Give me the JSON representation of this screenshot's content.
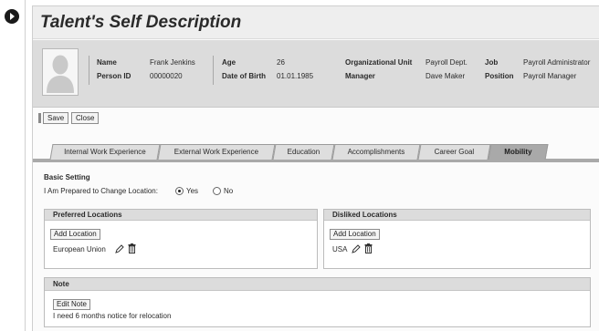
{
  "page": {
    "title": "Talent's Self Description"
  },
  "profile": {
    "name_label": "Name",
    "name_value": "Frank Jenkins",
    "person_id_label": "Person ID",
    "person_id_value": "00000020",
    "age_label": "Age",
    "age_value": "26",
    "dob_label": "Date of Birth",
    "dob_value": "01.01.1985",
    "org_unit_label": "Organizational Unit",
    "org_unit_value": "Payroll Dept.",
    "manager_label": "Manager",
    "manager_value": "Dave Maker",
    "job_label": "Job",
    "job_value": "Payroll Administrator",
    "position_label": "Position",
    "position_value": "Payroll Manager"
  },
  "toolbar": {
    "save_label": "Save",
    "close_label": "Close"
  },
  "tabs": [
    {
      "label": "Internal Work Experience",
      "active": false
    },
    {
      "label": "External Work Experience",
      "active": false
    },
    {
      "label": "Education",
      "active": false
    },
    {
      "label": "Accomplishments",
      "active": false
    },
    {
      "label": "Career Goal",
      "active": false
    },
    {
      "label": "Mobility",
      "active": true
    }
  ],
  "basic_setting": {
    "title": "Basic Setting",
    "prompt": "I Am Prepared to Change Location:",
    "options": [
      {
        "label": "Yes",
        "selected": true
      },
      {
        "label": "No",
        "selected": false
      }
    ]
  },
  "preferred_locations": {
    "title": "Preferred Locations",
    "add_button": "Add Location",
    "items": [
      "European Union"
    ]
  },
  "disliked_locations": {
    "title": "Disliked Locations",
    "add_button": "Add Location",
    "items": [
      "USA"
    ]
  },
  "note": {
    "title": "Note",
    "edit_button": "Edit Note",
    "text": "I need 6 months notice for relocation"
  },
  "colors": {
    "header_bg": "#dcdcdc",
    "active_tab": "#a9a9a9",
    "panel_head": "#dcdcdc"
  }
}
